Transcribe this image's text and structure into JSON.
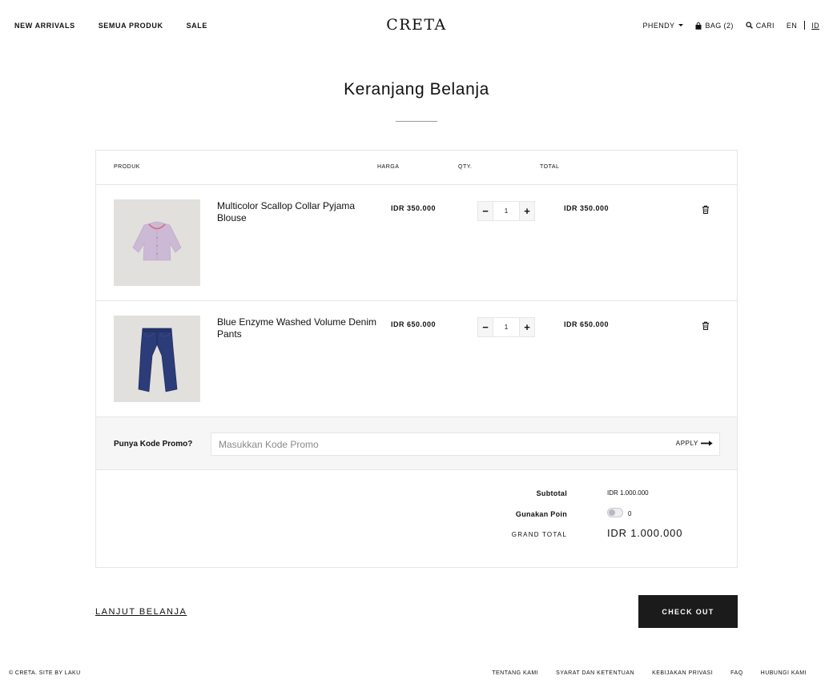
{
  "header": {
    "nav_left": [
      "NEW ARRIVALS",
      "SEMUA PRODUK",
      "SALE"
    ],
    "logo": "CRETA",
    "user": "PHENDY",
    "bag": "BAG (2)",
    "search": "CARI",
    "lang_en": "EN",
    "lang_id": "ID"
  },
  "page": {
    "title": "Keranjang Belanja"
  },
  "cart": {
    "columns": {
      "produk": "PRODUK",
      "harga": "HARGA",
      "qty": "QTY.",
      "total": "TOTAL"
    },
    "items": [
      {
        "name": "Multicolor Scallop Collar Pyjama Blouse",
        "price": "IDR 350.000",
        "qty": "1",
        "total": "IDR 350.000"
      },
      {
        "name": "Blue Enzyme Washed Volume Denim Pants",
        "price": "IDR 650.000",
        "qty": "1",
        "total": "IDR 650.000"
      }
    ],
    "promo": {
      "label": "Punya Kode Promo?",
      "placeholder": "Masukkan Kode Promo",
      "apply": "APPLY"
    },
    "summary": {
      "subtotal_label": "Subtotal",
      "subtotal_value": "IDR 1.000.000",
      "poin_label": "Gunakan Poin",
      "poin_value": "0",
      "grand_label": "GRAND TOTAL",
      "grand_value": "IDR 1.000.000"
    }
  },
  "actions": {
    "continue": "LANJUT BELANJA",
    "checkout": "CHECK OUT"
  },
  "footer": {
    "copyright": "© CRETA. SITE BY LAKU",
    "links": [
      "TENTANG KAMI",
      "SYARAT DAN KETENTUAN",
      "KEBIJAKAN PRIVASI",
      "FAQ",
      "HUBUNGI KAMI"
    ]
  },
  "colors": {
    "checkout_bg": "#1b1b1b",
    "promo_bg": "#f5f6f5",
    "thumb_bg": "#e2e0dd"
  }
}
